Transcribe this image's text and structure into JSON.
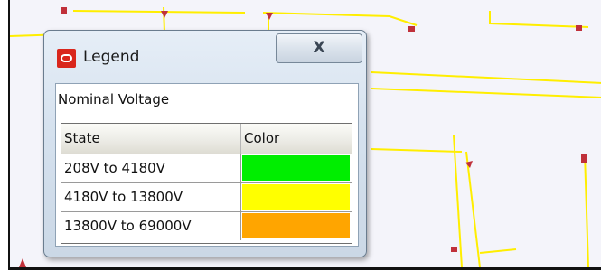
{
  "window": {
    "title": "Legend",
    "close_glyph": "X"
  },
  "legend": {
    "heading": "Nominal Voltage",
    "columns": [
      "State",
      "Color"
    ],
    "rows": [
      {
        "state": "208V to 4180V",
        "color": "#00ee00"
      },
      {
        "state": "4180V to 13800V",
        "color": "#ffff00"
      },
      {
        "state": "13800V to 69000V",
        "color": "#ffa500"
      }
    ]
  },
  "map": {
    "line_color": "#ffee00",
    "marker_color": "#c0303a"
  }
}
